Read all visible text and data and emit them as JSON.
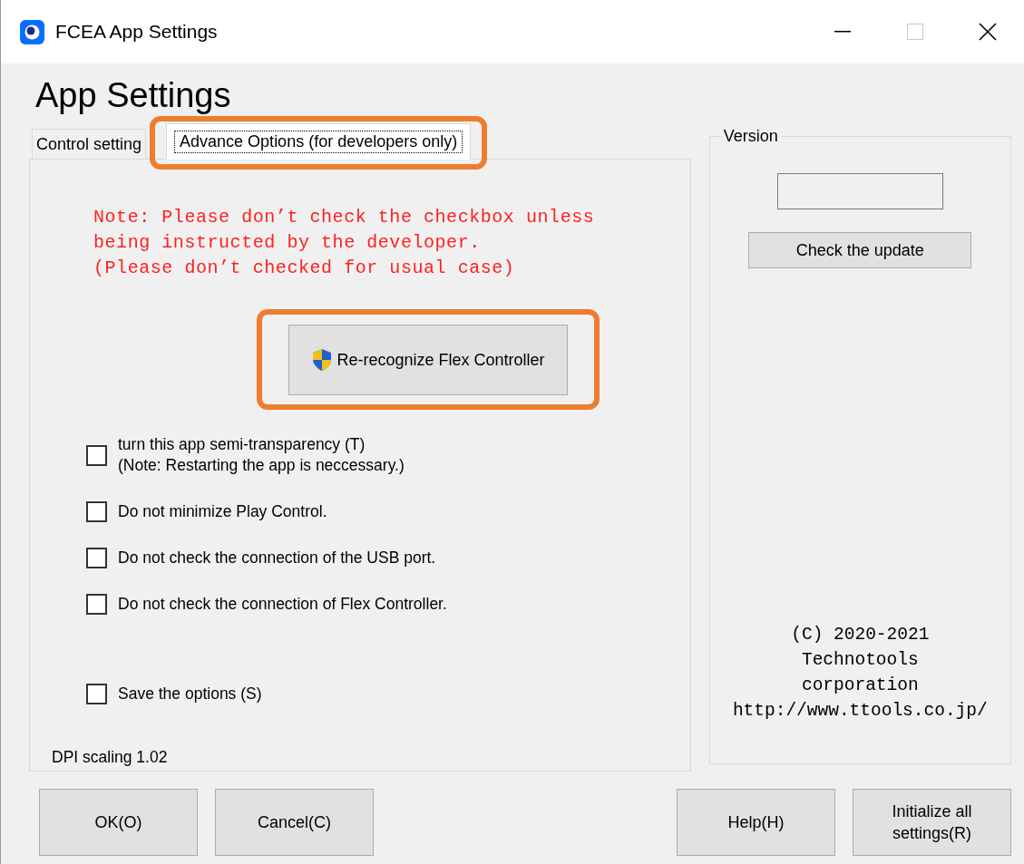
{
  "window": {
    "title": "FCEA App Settings"
  },
  "heading": "App Settings",
  "tabs": [
    {
      "label": "Control setting",
      "selected": false,
      "highlighted": false
    },
    {
      "label": "Advance Options (for developers only)",
      "selected": true,
      "highlighted": true
    }
  ],
  "note": "Note: Please don’t check the checkbox unless\nbeing instructed by the developer.\n(Please don’t checked for usual case)",
  "action_button": {
    "label": "Re-recognize Flex Controller",
    "highlighted": true
  },
  "options": [
    {
      "label": "turn this app semi-transparency (T)",
      "note": "(Note: Restarting the app is neccessary.)",
      "checked": false
    },
    {
      "label": "Do not minimize Play Control.",
      "checked": false
    },
    {
      "label": "Do not check the connection of the USB port.",
      "checked": false
    },
    {
      "label": "Do not check the connection of Flex Controller.",
      "checked": false
    },
    {
      "label": "Save the options (S)",
      "checked": false
    }
  ],
  "dpi": "DPI scaling 1.02",
  "version": {
    "legend": "Version",
    "button": "Check the update",
    "copyright": "(C) 2020-2021\nTechnotools\ncorporation\nhttp://www.ttools.co.jp/"
  },
  "buttons_left": [
    "OK(O)",
    "Cancel(C)"
  ],
  "buttons_right": [
    "Help(H)",
    "Initialize all\nsettings(R)"
  ]
}
